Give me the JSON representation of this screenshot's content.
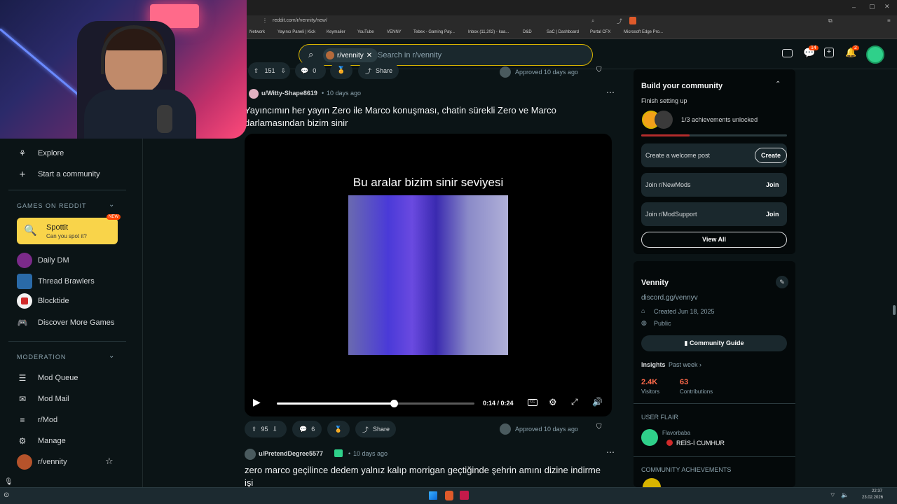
{
  "browser": {
    "url": "reddit.com/r/vennity/new/",
    "bookmarks": [
      "Network",
      "Yayıncı Paneli | Kick",
      "Keymailer",
      "YouTube",
      "VENNY",
      "Tebex - Gaming Pay...",
      "Inbox (11,202) - kaa...",
      "D&D",
      "SaC | Dashboard",
      "Portal CFX",
      "Microsoft Edge Pro..."
    ]
  },
  "header": {
    "community_chip": "r/vennity",
    "search_placeholder": "Search in r/vennity",
    "chat_badge": "14",
    "notif_badge": "2"
  },
  "sidebar": {
    "explore": "Explore",
    "start_community": "Start a community",
    "games_header": "GAMES ON REDDIT",
    "spottit": {
      "title": "Spottit",
      "subtitle": "Can you spot it?",
      "badge": "NEW"
    },
    "games": [
      "Daily DM",
      "Thread Brawlers",
      "Blocktide",
      "Discover More Games"
    ],
    "moderation_header": "MODERATION",
    "mod_items": [
      "Mod Queue",
      "Mod Mail",
      "r/Mod",
      "Manage",
      "r/vennity"
    ]
  },
  "feed": {
    "top_post_actions": {
      "votes": "151",
      "comments": "0",
      "share": "Share",
      "approved": "Approved 10 days ago"
    },
    "post1": {
      "author": "u/Witty-Shape8619",
      "time": "10 days ago",
      "title": "Yayıncımın her yayın Zero ile Marco konuşması, chatin sürekli Zero ve Marco darlamasından bizim sinir",
      "video_caption": "Bu aralar bizim sinir seviyesi",
      "video_time": "0:14 / 0:24",
      "video_progress": 0.59,
      "votes": "95",
      "comments": "6",
      "share": "Share",
      "approved": "Approved 10 days ago"
    },
    "post2": {
      "author": "u/PretendDegree5577",
      "time": "10 days ago",
      "title": "zero marco geçilince dedem yalnız kalıp morrigan geçtiğinde şehrin amını dizine indirme işi"
    }
  },
  "right": {
    "build": {
      "title": "Build your community",
      "subtitle": "Finish setting up",
      "achievements": "1/3 achievements unlocked",
      "progress": 0.33,
      "welcome": "Create a welcome post",
      "create": "Create",
      "join1": "Join r/NewMods",
      "join2": "Join r/ModSupport",
      "join": "Join",
      "view_all": "View All"
    },
    "about": {
      "name": "Vennity",
      "discord": "discord.gg/vennyv",
      "created": "Created Jun 18, 2025",
      "public": "Public",
      "guide": "Community Guide",
      "insights": "Insights",
      "past_week": "Past week",
      "visitors_val": "2.4K",
      "visitors_label": "Visitors",
      "contrib_val": "63",
      "contrib_label": "Contributions",
      "flair_header": "USER FLAIR",
      "flair_user": "Flavorbaba",
      "flair_text": "REİS-İ CUMHUR",
      "achv_header": "COMMUNITY ACHIEVEMENTS"
    }
  },
  "taskbar": {
    "time": "22:37",
    "date": "23.02.2026"
  },
  "colors": {
    "accent_yellow": "#d8b400",
    "reddit_orange": "#ff4500",
    "progress_red": "#b42c2c"
  }
}
